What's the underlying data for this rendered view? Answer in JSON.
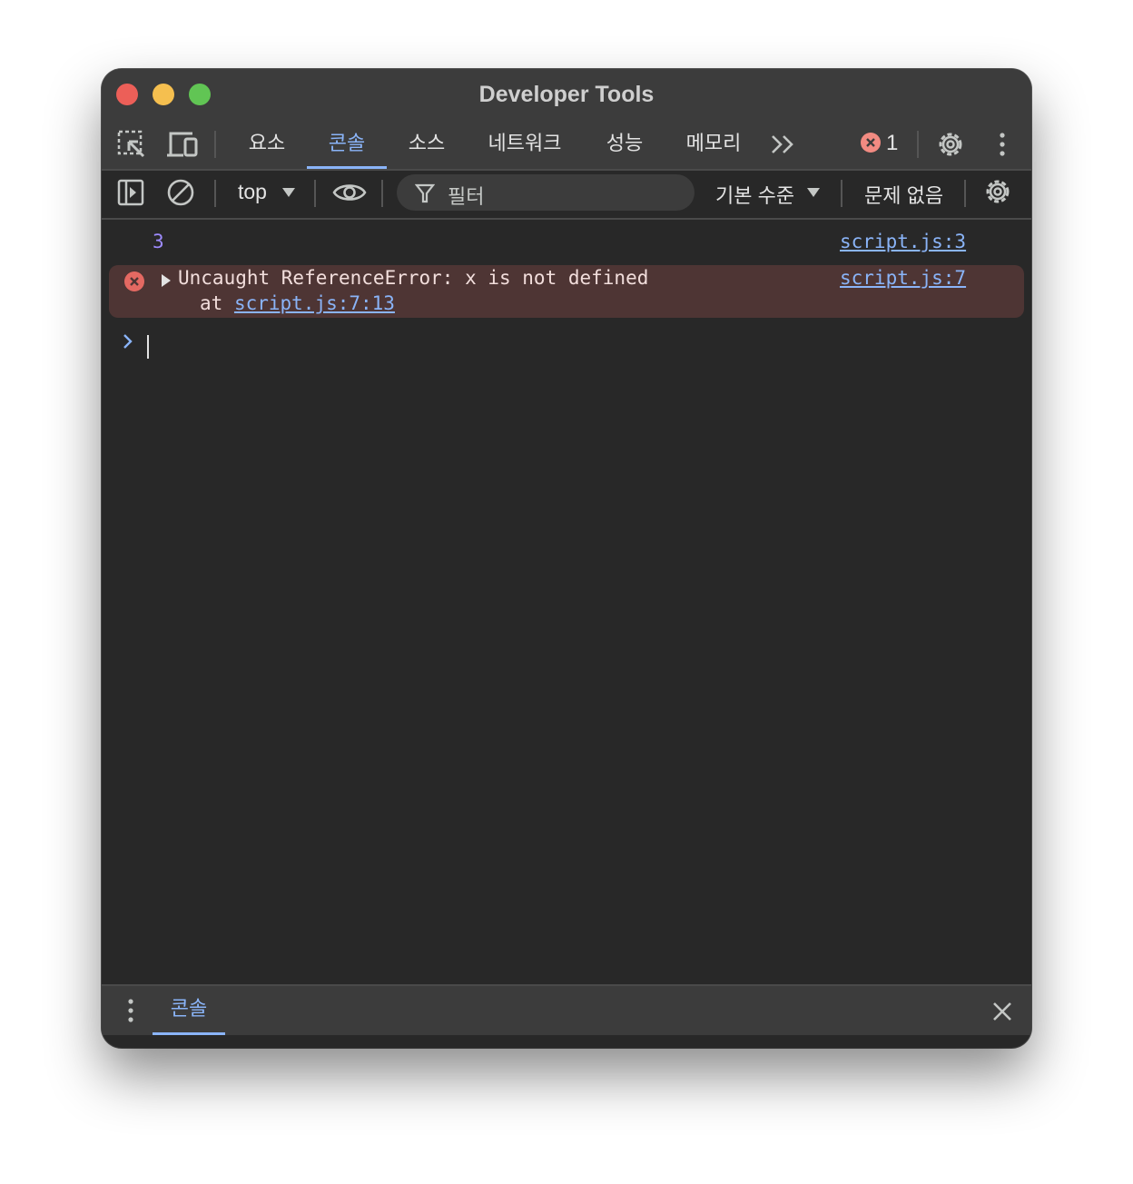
{
  "window": {
    "title": "Developer Tools"
  },
  "tabs": [
    {
      "label": "요소",
      "active": false
    },
    {
      "label": "콘솔",
      "active": true
    },
    {
      "label": "소스",
      "active": false
    },
    {
      "label": "네트워크",
      "active": false
    },
    {
      "label": "성능",
      "active": false
    },
    {
      "label": "메모리",
      "active": false
    }
  ],
  "error_badge": {
    "count": "1"
  },
  "toolbar": {
    "context": "top",
    "filter_placeholder": "필터",
    "log_level": "기본 수준",
    "issues": "문제 없음"
  },
  "console": {
    "messages": [
      {
        "type": "log",
        "value": "3",
        "source": "script.js:3"
      },
      {
        "type": "error",
        "text": "Uncaught ReferenceError: x is not defined",
        "stack_prefix": "at ",
        "stack_link": "script.js:7:13",
        "source": "script.js:7"
      }
    ]
  },
  "drawer": {
    "tab_label": "콘솔"
  },
  "colors": {
    "accent": "#8ab4f8",
    "error": "#f28b82",
    "error_bg": "#4e3534",
    "background": "#282828"
  }
}
